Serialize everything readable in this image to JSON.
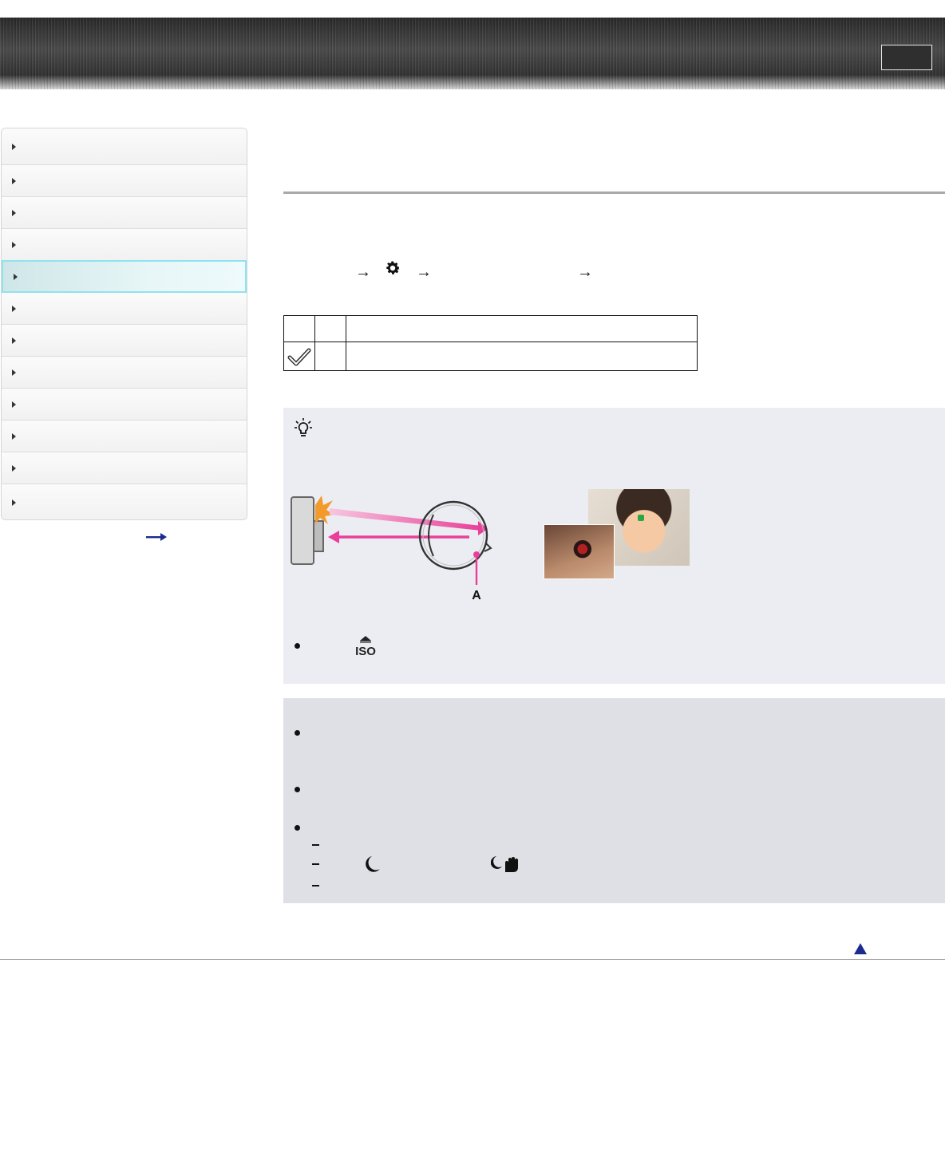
{
  "header": {
    "banner_button_label": ""
  },
  "sidebar": {
    "items": [
      {
        "label": ""
      },
      {
        "label": ""
      },
      {
        "label": ""
      },
      {
        "label": ""
      },
      {
        "label": "",
        "active": true
      },
      {
        "label": ""
      },
      {
        "label": ""
      },
      {
        "label": ""
      },
      {
        "label": ""
      },
      {
        "label": ""
      },
      {
        "label": ""
      },
      {
        "label": ""
      }
    ]
  },
  "diagram": {
    "label_a": "A"
  },
  "colors": {
    "accent_active": "#8fe3ef",
    "arrow_pink": "#e8409a",
    "top_arrow": "#1b2b8f"
  }
}
